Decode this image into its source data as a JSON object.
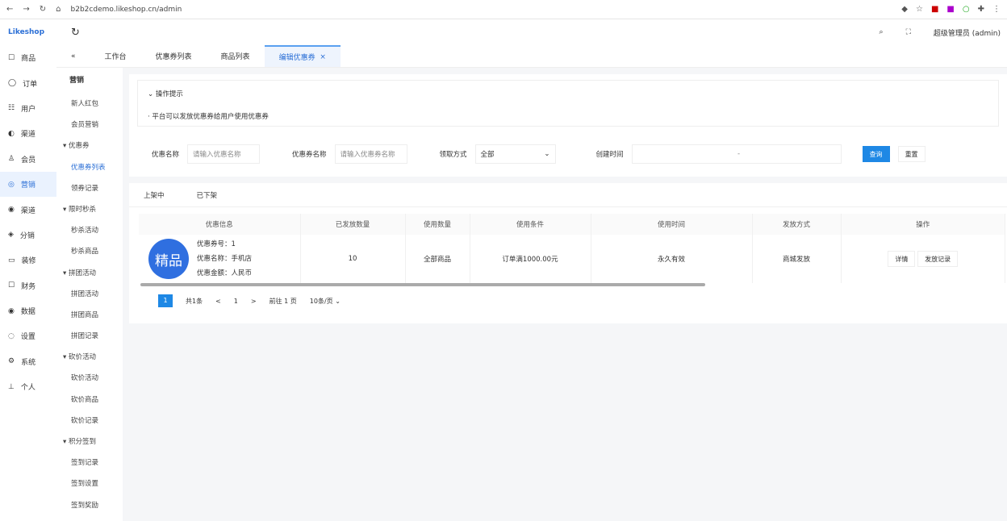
{
  "browser": {
    "url": "b2b2cdemo.likeshop.cn/admin"
  },
  "app": {
    "logo": "Likeshop",
    "user": "超级管理员 (admin)"
  },
  "sidebar": [
    "商品",
    "订单",
    "用户",
    "渠道",
    "会员",
    "营销",
    "渠道",
    "分销",
    "装修",
    "财务",
    "数据",
    "设置",
    "系统",
    "个人"
  ],
  "active_sidebar": 5,
  "tabs": [
    "工作台",
    "优惠券列表",
    "商品列表",
    "编辑优惠券"
  ],
  "submenu": {
    "title": "营销",
    "items": [
      {
        "label": "新人红包",
        "type": "item"
      },
      {
        "label": "会员营销",
        "type": "item"
      },
      {
        "label": "优惠券",
        "type": "group"
      },
      {
        "label": "优惠券列表",
        "type": "item",
        "active": true
      },
      {
        "label": "领券记录",
        "type": "item"
      },
      {
        "label": "限时秒杀",
        "type": "group"
      },
      {
        "label": "秒杀活动",
        "type": "item"
      },
      {
        "label": "秒杀商品",
        "type": "item"
      },
      {
        "label": "拼团活动",
        "type": "group"
      },
      {
        "label": "拼团活动",
        "type": "item"
      },
      {
        "label": "拼团商品",
        "type": "item"
      },
      {
        "label": "拼团记录",
        "type": "item"
      },
      {
        "label": "砍价活动",
        "type": "group"
      },
      {
        "label": "砍价活动",
        "type": "item"
      },
      {
        "label": "砍价商品",
        "type": "item"
      },
      {
        "label": "砍价记录",
        "type": "item"
      },
      {
        "label": "积分签到",
        "type": "group"
      },
      {
        "label": "签到记录",
        "type": "item"
      },
      {
        "label": "签到设置",
        "type": "item"
      },
      {
        "label": "签到奖励",
        "type": "item"
      }
    ]
  },
  "tips": {
    "title": "操作提示",
    "text": "· 平台可以发放优惠券给用户使用优惠券"
  },
  "filters": {
    "name_label": "优惠名称",
    "name_ph": "请输入优惠名称",
    "coupon_label": "优惠券名称",
    "coupon_ph": "请输入优惠券名称",
    "method_label": "领取方式",
    "method_value": "全部",
    "time_label": "创建时间",
    "time_sep": "-",
    "query": "查询",
    "reset": "重置"
  },
  "list_tabs": [
    "上架中",
    "已下架"
  ],
  "table": {
    "headers": [
      "优惠信息",
      "已发放数量",
      "使用数量",
      "使用条件",
      "使用时间",
      "发放方式",
      "操作"
    ],
    "rows": [
      {
        "badge": "精品",
        "info": [
          "优惠券号：1",
          "优惠名称：手机店",
          "优惠金额：人民币"
        ],
        "issued": "10",
        "used": "全部商品",
        "cond": "订单满1000.00元",
        "time": "永久有效",
        "method": "商城发放",
        "actions": [
          "详情",
          "发放记录"
        ]
      }
    ]
  },
  "pager": {
    "page": "1",
    "total": "共1条",
    "prev": "<",
    "cur": "1",
    "next": ">",
    "goto": "前往",
    "goto_page": "1",
    "goto_suffix": "页",
    "size": "10条/页"
  }
}
